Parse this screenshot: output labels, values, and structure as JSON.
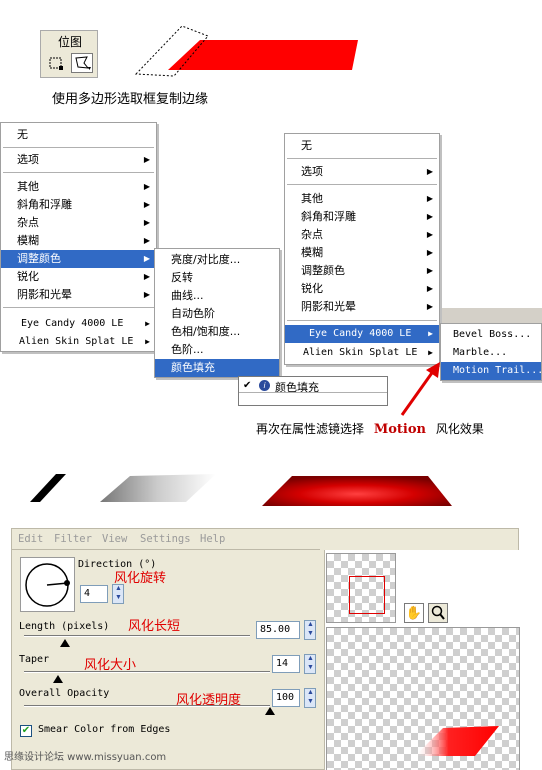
{
  "palette": {
    "title": "位图"
  },
  "captions": {
    "step1": "使用多边形选取框复制边缘",
    "step2_prefix": "再次在属性滤镜选择",
    "step2_bold": "Motion",
    "step2_suffix": "风化效果"
  },
  "menu_left": {
    "items": [
      {
        "label": "无",
        "submenu": false
      },
      {
        "label": "选项",
        "submenu": true
      },
      {
        "label": "其他",
        "submenu": true
      },
      {
        "label": "斜角和浮雕",
        "submenu": true
      },
      {
        "label": "杂点",
        "submenu": true
      },
      {
        "label": "模糊",
        "submenu": true
      },
      {
        "label": "调整颜色",
        "submenu": true,
        "highlighted": true
      },
      {
        "label": "锐化",
        "submenu": true
      },
      {
        "label": "阴影和光晕",
        "submenu": true
      },
      {
        "label": "Eye Candy 4000 LE",
        "submenu": true
      },
      {
        "label": "Alien Skin Splat LE",
        "submenu": true
      }
    ]
  },
  "submenu_adjust": {
    "items": [
      "亮度/对比度...",
      "反转",
      "曲线...",
      "自动色阶",
      "色相/饱和度...",
      "色阶...",
      "颜色填充"
    ],
    "highlighted": "颜色填充"
  },
  "menu_right": {
    "items": [
      {
        "label": "无",
        "submenu": false
      },
      {
        "label": "选项",
        "submenu": true
      },
      {
        "label": "其他",
        "submenu": true
      },
      {
        "label": "斜角和浮雕",
        "submenu": true
      },
      {
        "label": "杂点",
        "submenu": true
      },
      {
        "label": "模糊",
        "submenu": true
      },
      {
        "label": "调整颜色",
        "submenu": true
      },
      {
        "label": "锐化",
        "submenu": true
      },
      {
        "label": "阴影和光晕",
        "submenu": true
      },
      {
        "label": "Eye Candy 4000 LE",
        "submenu": true,
        "highlighted": true
      },
      {
        "label": "Alien Skin Splat LE",
        "submenu": true
      }
    ]
  },
  "submenu_eyecandy": {
    "items": [
      "Bevel Boss...",
      "Marble...",
      "Motion Trail..."
    ],
    "highlighted": "Motion Trail..."
  },
  "filter_list": {
    "item": "颜色填充"
  },
  "dialog": {
    "menubar": [
      "Edit",
      "Filter",
      "View",
      "Settings",
      "Help"
    ],
    "direction": {
      "label": "Direction (°)",
      "value": "4",
      "note": "风化旋转"
    },
    "length": {
      "label": "Length (pixels)",
      "value": "85.00",
      "note": "风化长短",
      "level": 0.18
    },
    "taper": {
      "label": "Taper",
      "value": "14",
      "note": "风化大小",
      "level": 0.14
    },
    "opacity": {
      "label": "Overall Opacity",
      "value": "100",
      "note": "风化透明度",
      "level": 1.0
    },
    "smear": {
      "label": "Smear Color from Edges",
      "checked": true
    }
  },
  "watermark": "思缘设计论坛 www.missyuan.com",
  "colors": {
    "accent_red": "#e00000",
    "menu_highlight": "#316ac5",
    "dialog_bg": "#ece9d8"
  }
}
